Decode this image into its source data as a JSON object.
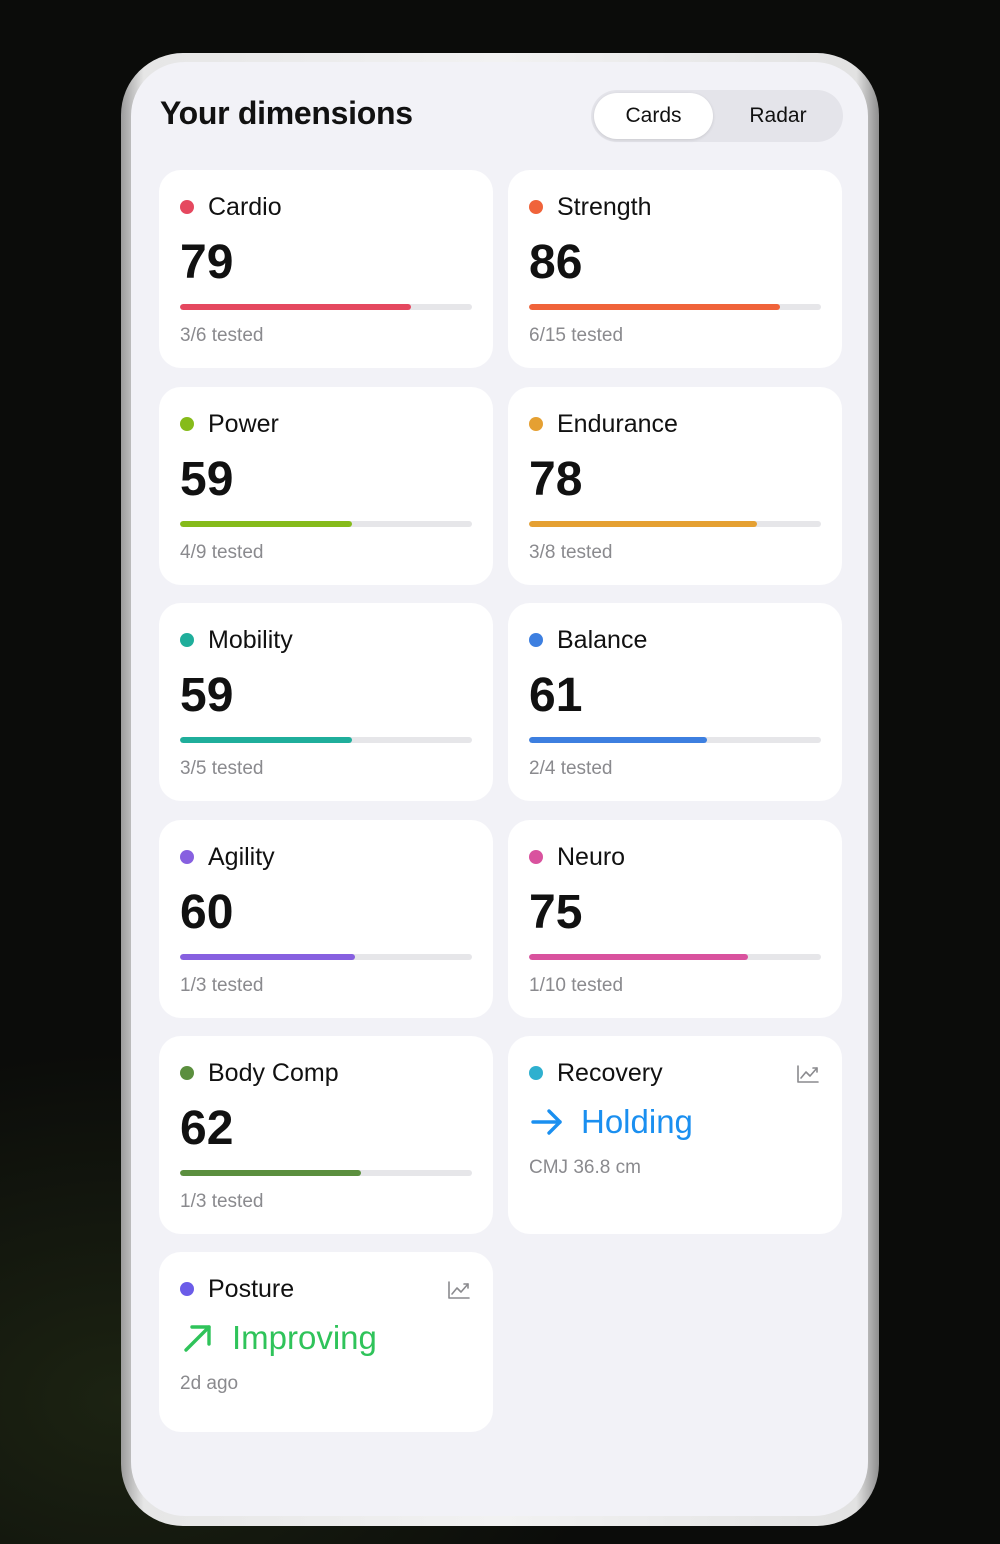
{
  "header": {
    "title": "Your dimensions",
    "view_toggle": {
      "cards": "Cards",
      "radar": "Radar",
      "selected": "Cards"
    }
  },
  "dimensions": [
    {
      "name": "Cardio",
      "score": "79",
      "progress": 0.79,
      "tested": "3/6 tested",
      "color": "#e5485f"
    },
    {
      "name": "Strength",
      "score": "86",
      "progress": 0.86,
      "tested": "6/15 tested",
      "color": "#f0633a"
    },
    {
      "name": "Power",
      "score": "59",
      "progress": 0.59,
      "tested": "4/9 tested",
      "color": "#86bb1a"
    },
    {
      "name": "Endurance",
      "score": "78",
      "progress": 0.78,
      "tested": "3/8 tested",
      "color": "#e5a032"
    },
    {
      "name": "Mobility",
      "score": "59",
      "progress": 0.59,
      "tested": "3/5 tested",
      "color": "#1fae9b"
    },
    {
      "name": "Balance",
      "score": "61",
      "progress": 0.61,
      "tested": "2/4 tested",
      "color": "#3d7fe0"
    },
    {
      "name": "Agility",
      "score": "60",
      "progress": 0.6,
      "tested": "1/3 tested",
      "color": "#8760e0"
    },
    {
      "name": "Neuro",
      "score": "75",
      "progress": 0.75,
      "tested": "1/10 tested",
      "color": "#d9529e"
    },
    {
      "name": "Body Comp",
      "score": "62",
      "progress": 0.62,
      "tested": "1/3 tested",
      "color": "#5b8f3e"
    }
  ],
  "trends": [
    {
      "name": "Recovery",
      "status": "Holding",
      "detail": "CMJ 36.8 cm",
      "dot_color": "#2fb0cf",
      "status_color": "#1a8ff0",
      "arrow": "arrow-right-icon"
    },
    {
      "name": "Posture",
      "status": "Improving",
      "detail": "2d ago",
      "dot_color": "#6b5ce8",
      "status_color": "#2fc35a",
      "arrow": "arrow-up-right-icon"
    }
  ]
}
